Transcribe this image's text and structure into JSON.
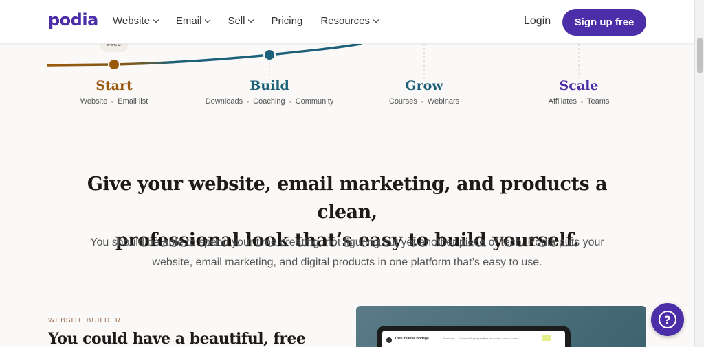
{
  "header": {
    "logo": "podia",
    "nav": [
      {
        "label": "Website",
        "dropdown": true
      },
      {
        "label": "Email",
        "dropdown": true
      },
      {
        "label": "Sell",
        "dropdown": true
      },
      {
        "label": "Pricing",
        "dropdown": false
      },
      {
        "label": "Resources",
        "dropdown": true
      }
    ],
    "login": "Login",
    "signup": "Sign up free"
  },
  "timeline": {
    "badge": "Free",
    "stages": [
      {
        "title": "Start",
        "color": "#9a5a0e",
        "tags": [
          "Website",
          "Email list"
        ]
      },
      {
        "title": "Build",
        "color": "#1d6079",
        "tags": [
          "Downloads",
          "Coaching",
          "Community"
        ]
      },
      {
        "title": "Grow",
        "color": "#1d6079",
        "tags": [
          "Courses",
          "Webinars"
        ]
      },
      {
        "title": "Scale",
        "color": "#4b2ea8",
        "tags": [
          "Affiliates",
          "Teams"
        ]
      }
    ]
  },
  "hero": {
    "headline_line1": "Give your website, email marketing, and products a clean,",
    "headline_line2": "professional look that’s easy to build yourself.",
    "subtext_line1": "You should be able to spend your time creating, not figuring out yet another piece of tech. Podia puts your",
    "subtext_line2": "website, email marketing, and digital products in one platform that’s easy to use."
  },
  "website_builder": {
    "eyebrow": "WEBSITE BUILDER",
    "title": "You could have a beautiful, free",
    "preview_brand": "The Creative Bodega",
    "preview_nav": [
      "About me",
      "Courses & programs",
      "Free resources",
      "Join our crew"
    ]
  },
  "colors": {
    "brand": "#4b2ea8",
    "start": "#9a5a0e",
    "build": "#1d6079"
  }
}
